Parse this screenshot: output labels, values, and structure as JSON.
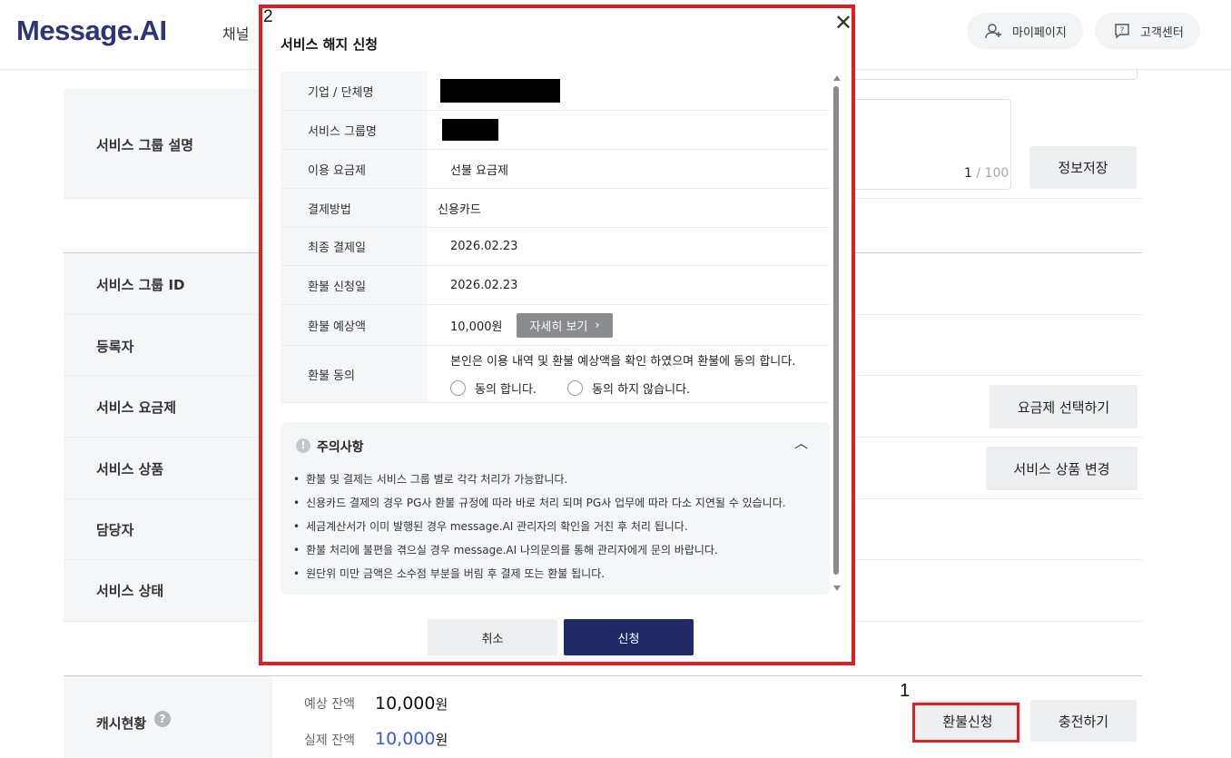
{
  "header": {
    "logo": "Message.AI",
    "nav_item": "채널",
    "mypage_label": "마이페이지",
    "support_label": "고객센터"
  },
  "form": {
    "desc_label": "서비스 그룹 설명",
    "desc_counter_current": "1",
    "desc_counter_max": "/ 100",
    "save_button": "정보저장",
    "group_id_label": "서비스 그룹 ID",
    "registrant_label": "등록자",
    "plan_label": "서비스 요금제",
    "plan_select_button": "요금제 선택하기",
    "product_label": "서비스 상품",
    "product_change_button": "서비스 상품 변경",
    "manager_label": "담당자",
    "status_label": "서비스 상태"
  },
  "cash": {
    "label": "캐시현황",
    "help": "?",
    "expected_label": "예상 잔액",
    "expected_value": "10,000",
    "actual_label": "실제 잔액",
    "actual_value": "10,000",
    "unit": "원",
    "refund_button": "환불신청",
    "charge_button": "충전하기"
  },
  "annotations": {
    "one": "1",
    "two": "2"
  },
  "modal": {
    "title": "서비스 해지 신청",
    "close": "✕",
    "rows": [
      {
        "key": "기업 / 단체명",
        "value": ""
      },
      {
        "key": "서비스 그룹명",
        "value": ""
      },
      {
        "key": "이용 요금제",
        "value": "선불 요금제"
      },
      {
        "key": "결제방법",
        "value": "신용카드"
      },
      {
        "key": "최종 결제일",
        "value": "2026.02.23"
      },
      {
        "key": "환불 신청일",
        "value": "2026.02.23"
      },
      {
        "key": "환불 예상액",
        "value": "10,000원"
      },
      {
        "key": "환불 동의",
        "value": "본인은 이용 내역 및 환불 예상액을 확인 하였으며 환불에 동의 합니다."
      }
    ],
    "detail_button": "자세히 보기",
    "agree_option": "동의 합니다.",
    "disagree_option": "동의 하지 않습니다.",
    "notice_title": "주의사항",
    "notice_icon": "!",
    "notices": [
      "환불 및 결제는 서비스 그룹 별로 각각 처리가 가능합니다.",
      "신용카드 결제의 경우 PG사 환불 규정에 따라 바로 처리 되며 PG사 업무에 따라 다소 지연될 수 있습니다.",
      "세금계산서가 이미 발행된 경우 message.AI 관리자의 확인을 거친 후 처리 됩니다.",
      "환불 처리에 불편을 겪으실 경우 message.AI 나의문의를 통해 관리자에게 문의 바랍니다.",
      "원단위 미만 금액은 소수점 부분을 버림 후 결제 또는 환불 됩니다."
    ],
    "cancel_button": "취소",
    "apply_button": "신청"
  }
}
